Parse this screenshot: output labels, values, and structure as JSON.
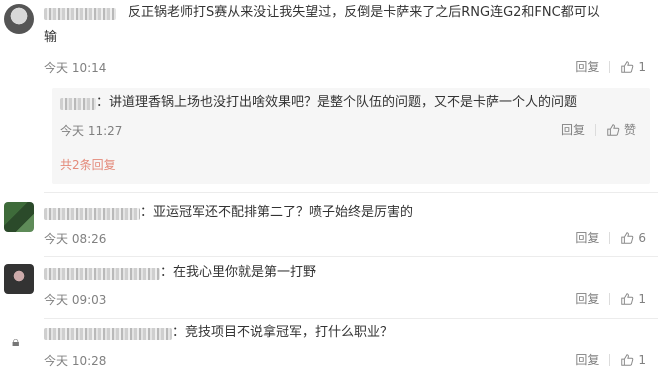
{
  "comments": [
    {
      "text_line1": "反正锅老师打S赛从来没让我失望过，反倒是卡萨来了之后RNG连G2和FNC都可以",
      "text_line2": "输",
      "time": "今天 10:14",
      "reply": "回复",
      "likes": "1",
      "sub": {
        "text": "：讲道理香锅上场也没打出啥效果吧？是整个队伍的问题，又不是卡萨一个人的问题",
        "time": "今天 11:27",
        "reply": "回复",
        "likes": "赞",
        "more": "共2条回复"
      }
    },
    {
      "text": "：亚运冠军还不配排第二了？喷子始终是厉害的",
      "time": "今天 08:26",
      "reply": "回复",
      "likes": "6"
    },
    {
      "text": "：在我心里你就是第一打野",
      "time": "今天 09:03",
      "reply": "回复",
      "likes": "1"
    },
    {
      "text": "：竞技项目不说拿冠军，打什么职业？",
      "time": "今天 10:28",
      "reply": "回复",
      "likes": "1"
    }
  ]
}
